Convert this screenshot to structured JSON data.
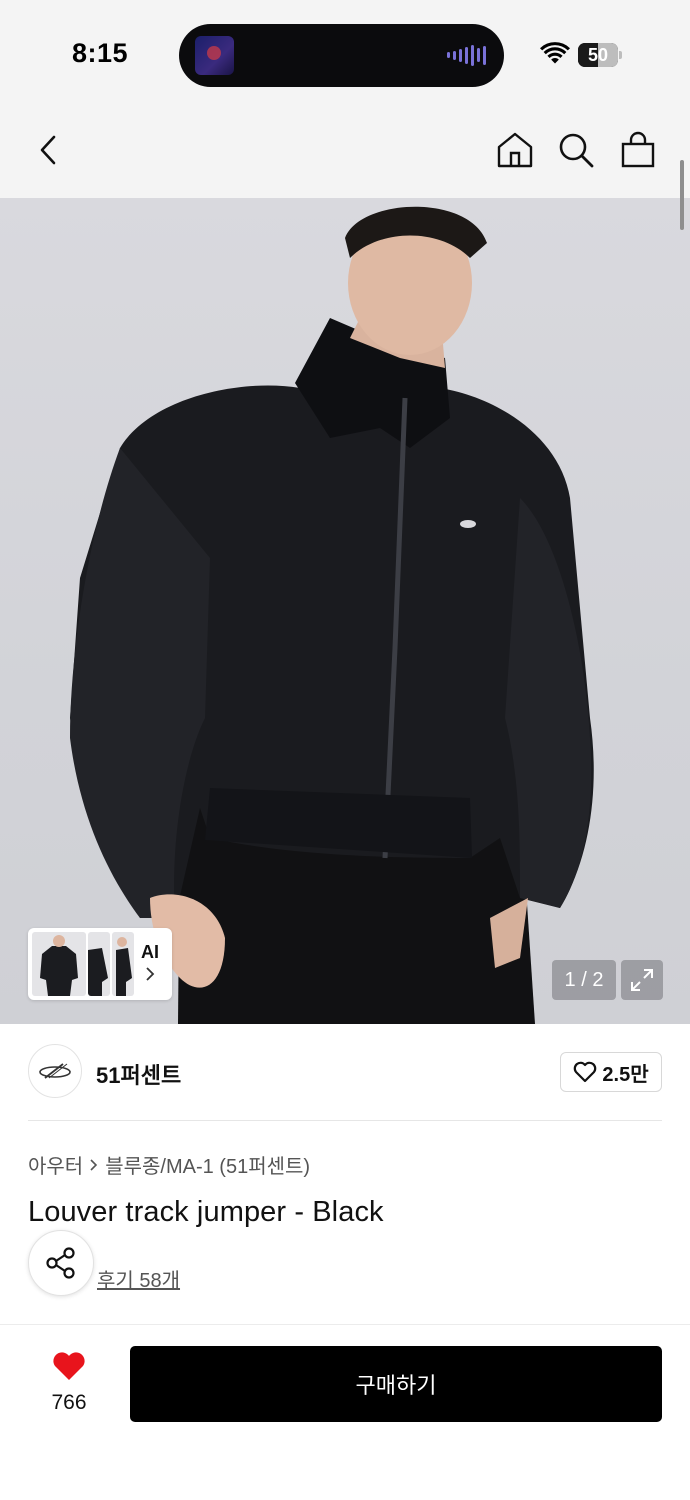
{
  "status_bar": {
    "time": "8:15",
    "battery_level": "50",
    "battery_fraction": 0.5,
    "icons": [
      "album-art-icon",
      "audio-wave-icon",
      "wifi-icon",
      "battery-icon"
    ]
  },
  "nav": {
    "icons": [
      "back-arrow-icon",
      "home-icon",
      "search-icon",
      "shopping-bag-icon"
    ]
  },
  "gallery": {
    "thumbnail_label": "AI",
    "page_indicator": "1 / 2",
    "icons": [
      "chevron-right-icon",
      "expand-icon"
    ]
  },
  "brand": {
    "name": "51퍼센트",
    "like_count": "2.5만",
    "icons": [
      "brand-logo-icon",
      "heart-outline-icon"
    ]
  },
  "product": {
    "breadcrumb": [
      "아우터",
      "블루종/MA-1 (51퍼센트)"
    ],
    "title": "Louver track jumper - Black",
    "review_link": "후기 58개"
  },
  "bottom_bar": {
    "wish_count": "766",
    "buy_label": "구매하기",
    "icons": [
      "heart-filled-icon",
      "share-icon"
    ]
  },
  "colors": {
    "header_bg": "#f4f4f4",
    "buy_button_bg": "#000000",
    "heart_red": "#e8141c",
    "image_bg": "#d4d5da"
  }
}
